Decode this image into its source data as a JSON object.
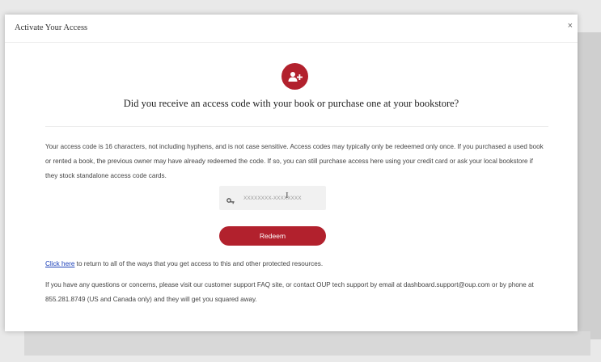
{
  "modal": {
    "title": "Activate Your Access",
    "close_label": "×"
  },
  "prompt": {
    "icon": "add-user-icon",
    "question": "Did you receive an access code with your book or purchase one at your bookstore?"
  },
  "info_text": "Your access code is 16 characters, not including hyphens, and is not case sensitive. Access codes may typically only be redeemed only once. If you purchased a used book or rented a book, the previous owner may have already redeemed the code. If so, you can still purchase access here using your credit card or ask your local bookstore if they stock standalone access code cards.",
  "code_field": {
    "icon": "key-icon",
    "placeholder": "XXXXXXXX-XXXXXXXX",
    "value": ""
  },
  "redeem_label": "Redeem",
  "return_line": {
    "link_text": "Click here",
    "text": " to return to all of the ways that you get access to this and other protected resources."
  },
  "contact_text": "If you have any questions or concerns, please visit our customer support FAQ site, or contact OUP tech support by email at dashboard.support@oup.com or by phone at 855.281.8749 (US and Canada only) and they will get you squared away.",
  "colors": {
    "accent": "#b2212d",
    "link": "#1a3fb8"
  }
}
